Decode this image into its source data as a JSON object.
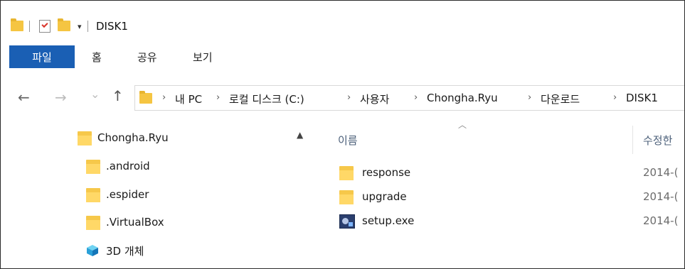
{
  "window": {
    "title": "DISK1"
  },
  "quick_access": {
    "dropdown_glyph": "▾"
  },
  "ribbon": {
    "tabs": [
      {
        "label": "파일"
      },
      {
        "label": "홈"
      },
      {
        "label": "공유"
      },
      {
        "label": "보기"
      }
    ]
  },
  "nav": {
    "back": "←",
    "forward": "→",
    "recent": "⌄",
    "up": "↑"
  },
  "address": {
    "separator": "›",
    "crumbs": [
      "내 PC",
      "로컬 디스크 (C:)",
      "사용자",
      "Chongha.Ryu",
      "다운로드",
      "DISK1"
    ]
  },
  "tree": {
    "items": [
      {
        "label": "Chongha.Ryu",
        "icon": "folder-icon"
      },
      {
        "label": ".android",
        "icon": "folder-icon"
      },
      {
        "label": ".espider",
        "icon": "folder-icon"
      },
      {
        "label": ".VirtualBox",
        "icon": "folder-icon"
      },
      {
        "label": "3D 개체",
        "icon": "3d-objects-icon"
      }
    ]
  },
  "file_list": {
    "columns": {
      "name": "이름",
      "modified": "수정한"
    },
    "rows": [
      {
        "name": "response",
        "modified": "2014-(",
        "icon": "folder-icon"
      },
      {
        "name": "upgrade",
        "modified": "2014-(",
        "icon": "folder-icon"
      },
      {
        "name": "setup.exe",
        "modified": "2014-(",
        "icon": "exe-icon"
      }
    ]
  },
  "colors": {
    "file_tab": "#1a5fb4",
    "folder": "#f5c542",
    "header_text": "#4c607a"
  }
}
